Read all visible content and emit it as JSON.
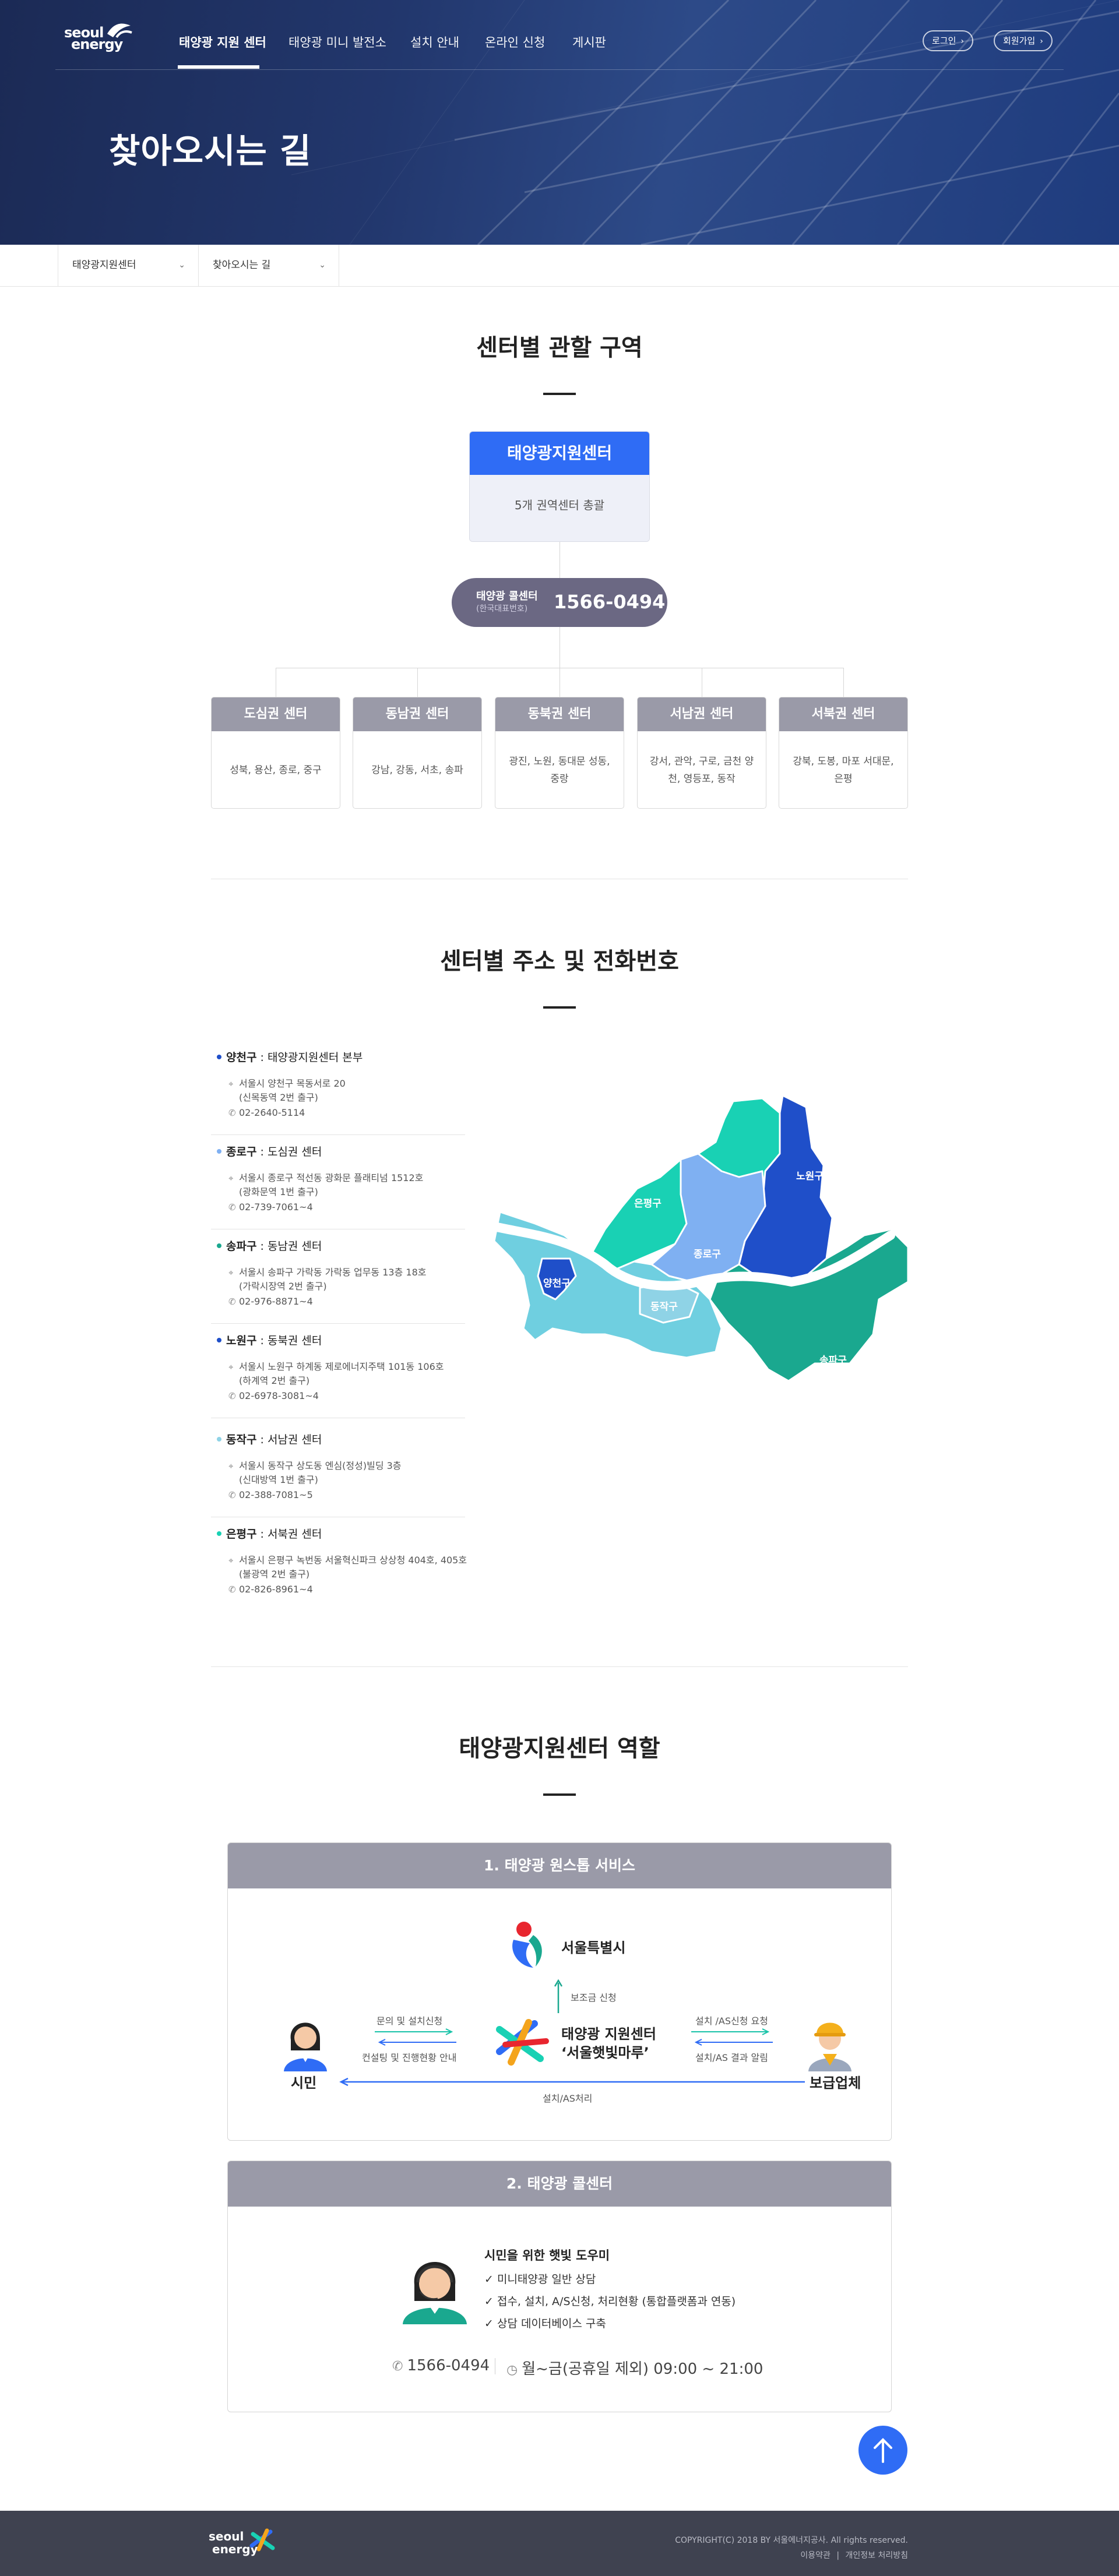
{
  "header": {
    "logo": {
      "line1": "seoul",
      "line2": "energy"
    },
    "menu": [
      "태양광 지원 센터",
      "태양광 미니 발전소",
      "설치 안내",
      "온라인 신청",
      "게시판"
    ],
    "login": "로그인",
    "signup": "회원가입",
    "page_title": "찾아오시는 길"
  },
  "breadcrumb": {
    "level1": "태양광지원센터",
    "level2": "찾아오시는 길"
  },
  "section1": {
    "title": "센터별 관할 구역",
    "top_box": {
      "title": "태양광지원센터",
      "desc": "5개 권역센터 총괄"
    },
    "call": {
      "label": "태양광 콜센터",
      "sub": "(한국대표번호)",
      "number": "1566-0494"
    },
    "regions": [
      {
        "name": "도심권 센터",
        "areas": "성북, 용산, 종로, 중구"
      },
      {
        "name": "동남권 센터",
        "areas": "강남, 강동, 서초, 송파"
      },
      {
        "name": "동북권 센터",
        "areas": "광진, 노원, 동대문 성동, 중랑"
      },
      {
        "name": "서남권 센터",
        "areas": "강서, 관악, 구로, 금천 양천, 영등포, 동작"
      },
      {
        "name": "서북권 센터",
        "areas": "강북, 도봉, 마포 서대문, 은평"
      }
    ]
  },
  "section2": {
    "title": "센터별 주소 및 전화번호",
    "items": [
      {
        "district": "양천구",
        "center": "태양광지원센터 본부",
        "addr1": "서울시 양천구 목동서로 20",
        "addr2": "(신목동역 2번 출구)",
        "tel": "02-2640-5114",
        "color": "#1f4fc9"
      },
      {
        "district": "종로구",
        "center": "도심권 센터",
        "addr1": "서울시 종로구 적선동 광화문 플래티넘 1512호",
        "addr2": "(광화문역 1번 출구)",
        "tel": "02-739-7061~4",
        "color": "#7fb0f2"
      },
      {
        "district": "송파구",
        "center": "동남권 센터",
        "addr1": "서울시 송파구 가락동 가락동 업무동 13층 18호",
        "addr2": "(가락시장역 2번 출구)",
        "tel": "02-976-8871~4",
        "color": "#1aa88f"
      },
      {
        "district": "노원구",
        "center": "동북권 센터",
        "addr1": "서울시 노원구 하계동 제로에너지주택 101동 106호",
        "addr2": "(하계역 2번 출구)",
        "tel": "02-6978-3081~4",
        "color": "#1f4fc9"
      },
      {
        "district": "동작구",
        "center": "서남권 센터",
        "addr1": "서울시 동작구 상도동 엔심(정성)빌딩 3층",
        "addr2": "(신대방역 1번 출구)",
        "tel": "02-388-7081~5",
        "color": "#8fd3e6"
      },
      {
        "district": "은평구",
        "center": "서북권 센터",
        "addr1": "서울시 은평구 녹번동 서울혁신파크 상상청 404호, 405호",
        "addr2": "(불광역 2번 출구)",
        "tel": "02-826-8961~4",
        "color": "#19d1b4"
      }
    ],
    "map_labels": [
      "노원구",
      "은평구",
      "종로구",
      "양천구",
      "동작구",
      "송파구"
    ]
  },
  "section3": {
    "title": "태양광지원센터 역할",
    "box1": {
      "title": "1. 태양광 원스톱 서비스",
      "seoul": "서울특별시",
      "subsidy": "보조금 신청",
      "center_l1": "태양광 지원센터",
      "center_l2": "‘서울햇빛마루’",
      "citizen": "시민",
      "installer": "보급업체",
      "c_to_center": "문의 및 설치신청",
      "center_to_c": "컨설팅 및 진행현황 안내",
      "center_to_i": "설치 /AS신청 요청",
      "i_to_center": "설치/AS 결과 알림",
      "bottom": "설치/AS처리"
    },
    "box2": {
      "title": "2. 태양광 콜센터",
      "heading": "시민을 위한 햇빛 도우미",
      "items": [
        "미니태양광 일반 상담",
        "접수, 설치, A/S신청, 처리현황 (통합플랫폼과 연동)",
        "상담 데이터베이스 구축"
      ],
      "phone": "1566-0494",
      "hours": "월~금(공휴일 제외) 09:00 ~ 21:00"
    }
  },
  "footer": {
    "copyright": "COPYRIGHT(C) 2018 BY 서울에너지공사. All rights reserved.",
    "terms": "이용약관",
    "privacy": "개인정보 처리방침"
  }
}
